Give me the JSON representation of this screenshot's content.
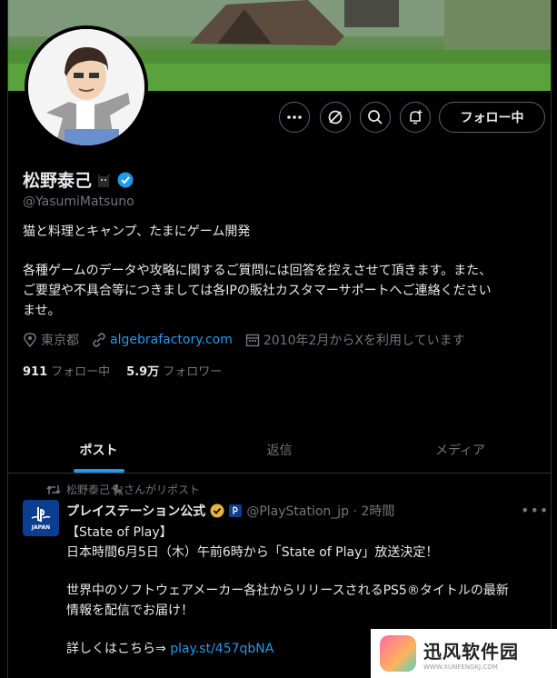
{
  "profile": {
    "name": "松野泰己",
    "handle": "@YasumiMatsuno",
    "bio_line1": "猫と料理とキャンプ、たまにゲーム開発",
    "bio_line2": "各種ゲームのデータや攻略に関するご質問には回答を控えさせて頂きます。また、",
    "bio_line3": "ご要望や不具合等につきましては各IPの販社カスタマーサポートへご連絡ください",
    "bio_line4": "ませ。",
    "location": "東京都",
    "website": "algebrafactory.com",
    "joined": "2010年2月からXを利用しています",
    "following_count": "911",
    "following_label": "フォロー中",
    "followers_count": "5.9万",
    "followers_label": "フォロワー",
    "follow_button": "フォロー中",
    "verified_color": "#1d9bf0"
  },
  "tabs": [
    "ポスト",
    "返信",
    "メディア"
  ],
  "post": {
    "repost_text": "松野泰己🐈‍⬛さんがリポスト",
    "author": "プレイステーション公式",
    "handle_time": "@PlayStation_jp · 2時間",
    "avatar_label": "JAPAN",
    "line1": "【State of Play】",
    "line2": "日本時間6月5日（木）午前6時から「State of Play」放送決定！",
    "line3": "世界中のソフトウェアメーカー各社からリリースされるPS5®タイトルの最新",
    "line4": "情報を配信でお届け！",
    "line5_prefix": "詳しくはこちら⇒",
    "line5_link": "play.st/457qbNA"
  },
  "watermark": {
    "title": "迅风软件园",
    "url": "WWW.XUNFENGKJ.COM"
  }
}
